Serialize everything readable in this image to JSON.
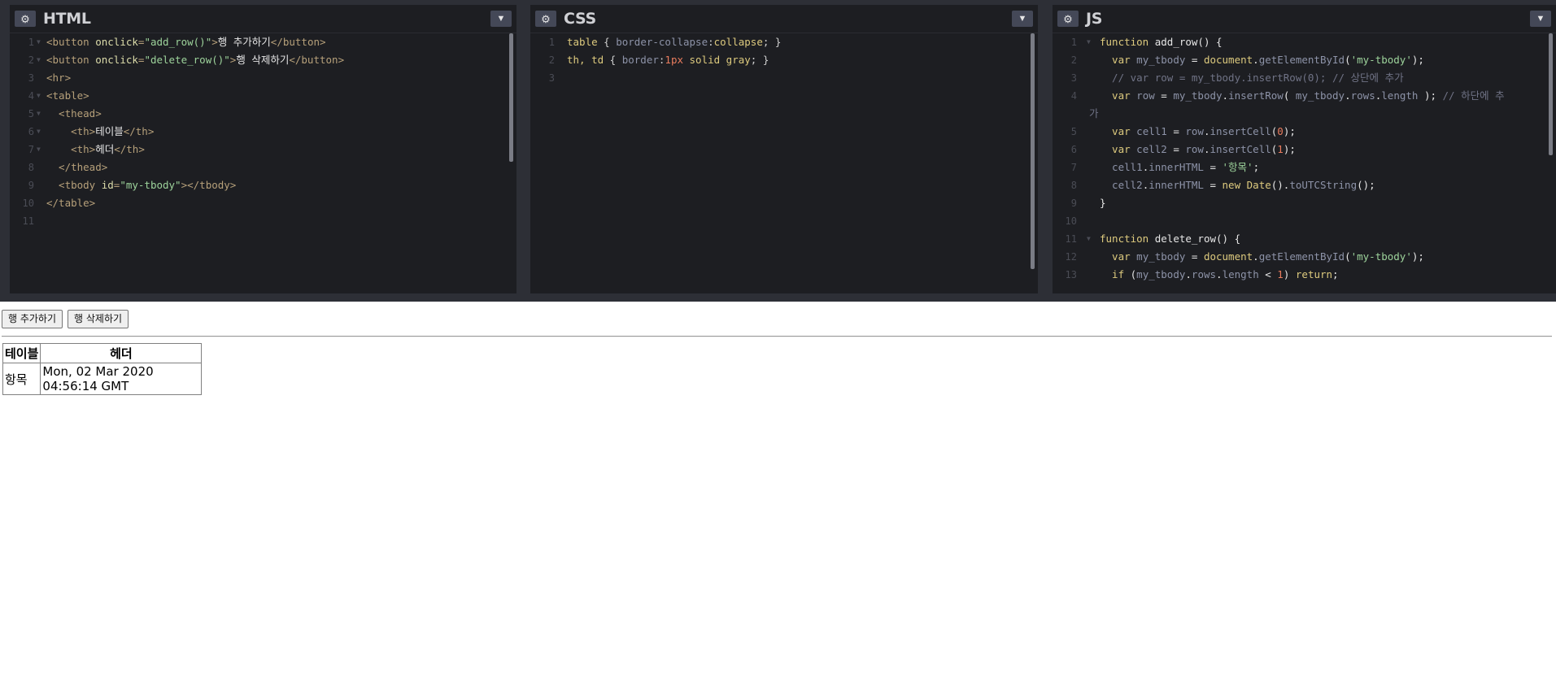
{
  "editors": {
    "html": {
      "title": "HTML",
      "gear_icon": "gear-icon",
      "chevron_icon": "chevron-down-icon",
      "lines": [
        {
          "n": "1",
          "fold": true,
          "parts": [
            [
              "tag",
              "<button "
            ],
            [
              "attr",
              "onclick"
            ],
            [
              "tag",
              "="
            ],
            [
              "str",
              "\"add_row()\""
            ],
            [
              "tag",
              ">"
            ],
            [
              "plain",
              "행 추가하기"
            ],
            [
              "tag",
              "</button>"
            ]
          ]
        },
        {
          "n": "2",
          "fold": true,
          "parts": [
            [
              "tag",
              "<button "
            ],
            [
              "attr",
              "onclick"
            ],
            [
              "tag",
              "="
            ],
            [
              "str",
              "\"delete_row()\""
            ],
            [
              "tag",
              ">"
            ],
            [
              "plain",
              "행 삭제하기"
            ],
            [
              "tag",
              "</button>"
            ]
          ]
        },
        {
          "n": "3",
          "fold": false,
          "parts": [
            [
              "tag",
              "<hr>"
            ]
          ]
        },
        {
          "n": "4",
          "fold": true,
          "parts": [
            [
              "tag",
              "<table>"
            ]
          ]
        },
        {
          "n": "5",
          "fold": true,
          "parts": [
            [
              "tag",
              "  <thead>"
            ]
          ]
        },
        {
          "n": "6",
          "fold": true,
          "parts": [
            [
              "tag",
              "    <th>"
            ],
            [
              "plain",
              "테이블"
            ],
            [
              "tag",
              "</th>"
            ]
          ]
        },
        {
          "n": "7",
          "fold": true,
          "parts": [
            [
              "tag",
              "    <th>"
            ],
            [
              "plain",
              "헤더"
            ],
            [
              "tag",
              "</th>"
            ]
          ]
        },
        {
          "n": "8",
          "fold": false,
          "parts": [
            [
              "tag",
              "  </thead>"
            ]
          ]
        },
        {
          "n": "9",
          "fold": false,
          "parts": [
            [
              "tag",
              "  <tbody "
            ],
            [
              "attr",
              "id"
            ],
            [
              "tag",
              "="
            ],
            [
              "str",
              "\"my-tbody\""
            ],
            [
              "tag",
              "></tbody>"
            ]
          ]
        },
        {
          "n": "10",
          "fold": false,
          "parts": [
            [
              "tag",
              "</table>"
            ]
          ]
        },
        {
          "n": "11",
          "fold": false,
          "parts": []
        }
      ]
    },
    "css": {
      "title": "CSS",
      "gear_icon": "gear-icon",
      "chevron_icon": "chevron-down-icon",
      "lines": [
        {
          "n": "1",
          "fold": false,
          "parts": [
            [
              "kw",
              "table"
            ],
            [
              "sel",
              " { "
            ],
            [
              "prop",
              "border-collapse"
            ],
            [
              "sel",
              ":"
            ],
            [
              "cssval",
              "collapse"
            ],
            [
              "sel",
              "; }"
            ]
          ]
        },
        {
          "n": "2",
          "fold": false,
          "parts": [
            [
              "kw",
              "th, td"
            ],
            [
              "sel",
              " { "
            ],
            [
              "prop",
              "border"
            ],
            [
              "sel",
              ":"
            ],
            [
              "num",
              "1px"
            ],
            [
              "cssval",
              " solid gray"
            ],
            [
              "sel",
              "; }"
            ]
          ]
        },
        {
          "n": "3",
          "fold": false,
          "parts": []
        }
      ]
    },
    "js": {
      "title": "JS",
      "gear_icon": "gear-icon",
      "chevron_icon": "chevron-down-icon",
      "lines": [
        {
          "n": "1",
          "fold": true,
          "parts": [
            [
              "kw",
              "function"
            ],
            [
              "plain",
              " add_row() {"
            ]
          ]
        },
        {
          "n": "2",
          "fold": false,
          "parts": [
            [
              "kw",
              "  var"
            ],
            [
              "prop",
              " my_tbody"
            ],
            [
              "plain",
              " = "
            ],
            [
              "kw",
              "document"
            ],
            [
              "plain",
              "."
            ],
            [
              "prop",
              "getElementById"
            ],
            [
              "plain",
              "("
            ],
            [
              "str",
              "'my-tbody'"
            ],
            [
              "plain",
              ");"
            ]
          ]
        },
        {
          "n": "3",
          "fold": false,
          "parts": [
            [
              "cmt",
              "  // var row = my_tbody.insertRow(0); // 상단에 추가"
            ]
          ]
        },
        {
          "n": "4",
          "fold": false,
          "parts": [
            [
              "kw",
              "  var"
            ],
            [
              "prop",
              " row"
            ],
            [
              "plain",
              " = "
            ],
            [
              "prop",
              "my_tbody"
            ],
            [
              "plain",
              "."
            ],
            [
              "prop",
              "insertRow"
            ],
            [
              "plain",
              "( "
            ],
            [
              "prop",
              "my_tbody"
            ],
            [
              "plain",
              "."
            ],
            [
              "prop",
              "rows"
            ],
            [
              "plain",
              "."
            ],
            [
              "prop",
              "length"
            ],
            [
              "plain",
              " ); "
            ],
            [
              "cmt",
              "// 하단에 추"
            ]
          ]
        },
        {
          "n": "",
          "fold": false,
          "wrap": true,
          "parts": [
            [
              "cmt",
              "가"
            ]
          ]
        },
        {
          "n": "5",
          "fold": false,
          "parts": [
            [
              "kw",
              "  var"
            ],
            [
              "prop",
              " cell1"
            ],
            [
              "plain",
              " = "
            ],
            [
              "prop",
              "row"
            ],
            [
              "plain",
              "."
            ],
            [
              "prop",
              "insertCell"
            ],
            [
              "plain",
              "("
            ],
            [
              "num",
              "0"
            ],
            [
              "plain",
              ");"
            ]
          ]
        },
        {
          "n": "6",
          "fold": false,
          "parts": [
            [
              "kw",
              "  var"
            ],
            [
              "prop",
              " cell2"
            ],
            [
              "plain",
              " = "
            ],
            [
              "prop",
              "row"
            ],
            [
              "plain",
              "."
            ],
            [
              "prop",
              "insertCell"
            ],
            [
              "plain",
              "("
            ],
            [
              "num",
              "1"
            ],
            [
              "plain",
              ");"
            ]
          ]
        },
        {
          "n": "7",
          "fold": false,
          "parts": [
            [
              "prop",
              "  cell1"
            ],
            [
              "plain",
              "."
            ],
            [
              "prop",
              "innerHTML"
            ],
            [
              "plain",
              " = "
            ],
            [
              "str",
              "'항목'"
            ],
            [
              "plain",
              ";"
            ]
          ]
        },
        {
          "n": "8",
          "fold": false,
          "parts": [
            [
              "prop",
              "  cell2"
            ],
            [
              "plain",
              "."
            ],
            [
              "prop",
              "innerHTML"
            ],
            [
              "plain",
              " = "
            ],
            [
              "kw",
              "new"
            ],
            [
              "plain",
              " "
            ],
            [
              "kw",
              "Date"
            ],
            [
              "plain",
              "()."
            ],
            [
              "prop",
              "toUTCString"
            ],
            [
              "plain",
              "();"
            ]
          ]
        },
        {
          "n": "9",
          "fold": false,
          "parts": [
            [
              "plain",
              "}"
            ]
          ]
        },
        {
          "n": "10",
          "fold": false,
          "parts": []
        },
        {
          "n": "11",
          "fold": true,
          "parts": [
            [
              "kw",
              "function"
            ],
            [
              "plain",
              " delete_row() {"
            ]
          ]
        },
        {
          "n": "12",
          "fold": false,
          "parts": [
            [
              "kw",
              "  var"
            ],
            [
              "prop",
              " my_tbody"
            ],
            [
              "plain",
              " = "
            ],
            [
              "kw",
              "document"
            ],
            [
              "plain",
              "."
            ],
            [
              "prop",
              "getElementById"
            ],
            [
              "plain",
              "("
            ],
            [
              "str",
              "'my-tbody'"
            ],
            [
              "plain",
              ");"
            ]
          ]
        },
        {
          "n": "13",
          "fold": false,
          "parts": [
            [
              "kw",
              "  if"
            ],
            [
              "plain",
              " ("
            ],
            [
              "prop",
              "my_tbody"
            ],
            [
              "plain",
              "."
            ],
            [
              "prop",
              "rows"
            ],
            [
              "plain",
              "."
            ],
            [
              "prop",
              "length"
            ],
            [
              "plain",
              " < "
            ],
            [
              "num",
              "1"
            ],
            [
              "plain",
              ") "
            ],
            [
              "kw",
              "return"
            ],
            [
              "plain",
              ";"
            ]
          ]
        }
      ]
    }
  },
  "preview": {
    "add_button": "행 추가하기",
    "delete_button": "행 삭제하기",
    "table": {
      "headers": [
        "테이블",
        "헤더"
      ],
      "rows": [
        [
          "항목",
          "Mon, 02 Mar 2020 04:56:14 GMT"
        ]
      ]
    }
  },
  "colors": {
    "editor_bg": "#1d1e22",
    "frame_bg": "#2d2f36",
    "button_bg": "#444857"
  }
}
